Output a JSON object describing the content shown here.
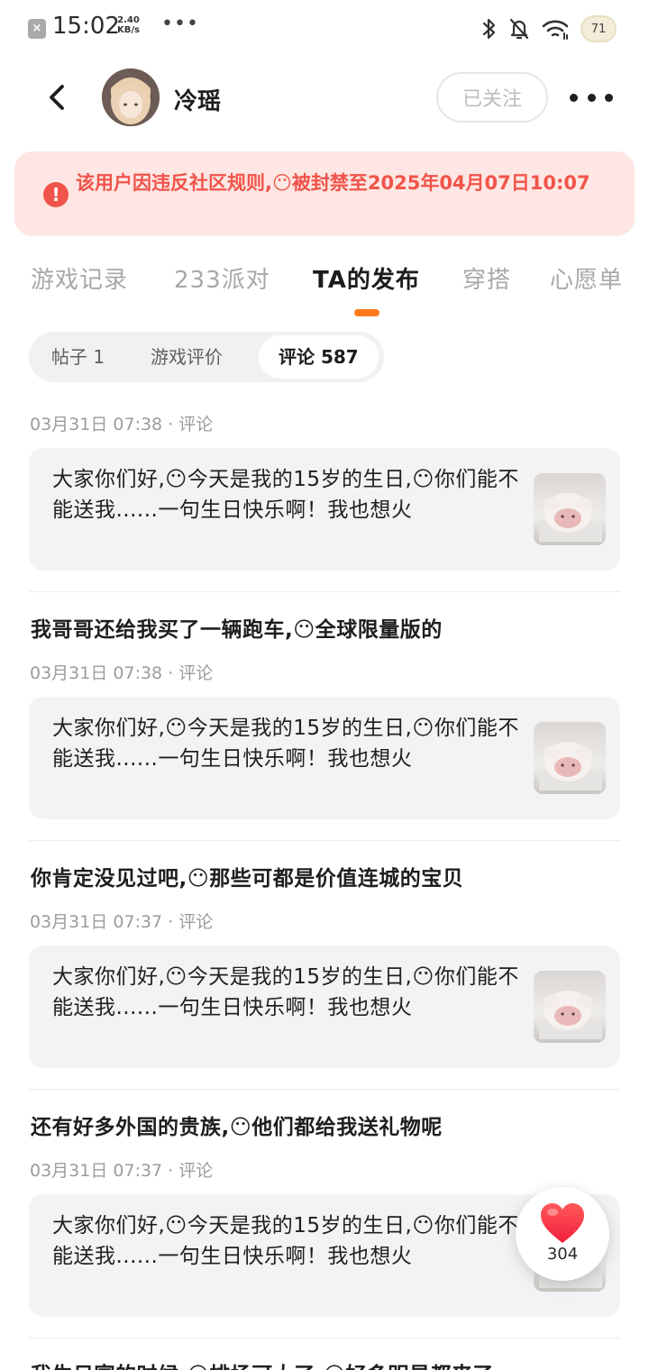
{
  "status_bar": {
    "time": "15:02",
    "speed_value": "2.40",
    "speed_unit": "KB/s",
    "more": "•••",
    "battery": "71"
  },
  "header": {
    "username": "冷瑶",
    "follow_label": "已关注"
  },
  "ban_notice": {
    "text": "该用户因违反社区规则,😶被封禁至2025年04月07日10:07"
  },
  "tabs": [
    {
      "label": "游戏记录"
    },
    {
      "label": "233派对"
    },
    {
      "label": "TA的发布"
    },
    {
      "label": "穿搭"
    },
    {
      "label": "心愿单"
    }
  ],
  "subtabs": [
    {
      "label": "帖子 1"
    },
    {
      "label": "游戏评价"
    },
    {
      "label": "评论 587"
    }
  ],
  "feed": [
    {
      "title": "",
      "meta": "03月31日 07:38 · 评论",
      "card_text": "大家你们好,😶今天是我的15岁的生日,😶你们能不能送我......一句生日快乐啊！我也想火"
    },
    {
      "title": "我哥哥还给我买了一辆跑车,😶全球限量版的",
      "meta": "03月31日 07:38 · 评论",
      "card_text": "大家你们好,😶今天是我的15岁的生日,😶你们能不能送我......一句生日快乐啊！我也想火"
    },
    {
      "title": "你肯定没见过吧,😶那些可都是价值连城的宝贝",
      "meta": "03月31日 07:37 · 评论",
      "card_text": "大家你们好,😶今天是我的15岁的生日,😶你们能不能送我......一句生日快乐啊！我也想火"
    },
    {
      "title": "还有好多外国的贵族,😶他们都给我送礼物呢",
      "meta": "03月31日 07:37 · 评论",
      "card_text": "大家你们好,😶今天是我的15岁的生日,😶你们能不能送我......一句生日快乐啊！我也想火"
    },
    {
      "title": "我生日宴的时候,😶排场可大了,😶好多明星都来了",
      "meta": "",
      "card_text": ""
    }
  ],
  "like": {
    "count": "304"
  },
  "colors": {
    "accent": "#ff7a1a",
    "ban_red": "#f0544a",
    "ban_bg": "#fde6e3"
  }
}
